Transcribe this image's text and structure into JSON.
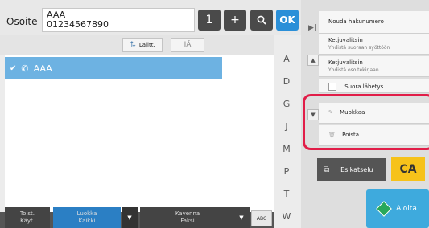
{
  "address": {
    "label": "Osoite",
    "name": "AAA",
    "number": "01234567890"
  },
  "toolbar": {
    "count": "1",
    "add": "+",
    "ok": "OK"
  },
  "sort": {
    "sort_label": "Lajitt.",
    "view_icon_text": "IĀ"
  },
  "list": {
    "selected": {
      "name": "AAA"
    }
  },
  "index": [
    "A",
    "D",
    "G",
    "J",
    "M",
    "P",
    "T",
    "W"
  ],
  "bottom": {
    "toist_line1": "Toist.",
    "toist_line2": "Käyt.",
    "luokka_line1": "Luokka",
    "luokka_line2": "Kaikki",
    "kavenna_line1": "Kavenna",
    "kavenna_line2": "Faksi",
    "abc": "ABC"
  },
  "panel": {
    "nouda": "Nouda hakunumero",
    "ketju1_title": "Ketjuvalitsin",
    "ketju1_sub": "Yhdistä suoraan syöttöön",
    "ketju2_title": "Ketjuvalitsin",
    "ketju2_sub": "Yhdistä osoitekirjaan",
    "suora": "Suora lähetys",
    "muokkaa": "Muokkaa",
    "poista": "Poista",
    "esikatselu": "Esikatselu",
    "ca": "CA",
    "aloita": "Aloita"
  },
  "colors": {
    "accent_blue": "#2a8fd8",
    "selected_row": "#6db2e2",
    "highlight_red": "#e11d48",
    "ca_yellow": "#f6c21a",
    "start_blue": "#3eaadd"
  }
}
